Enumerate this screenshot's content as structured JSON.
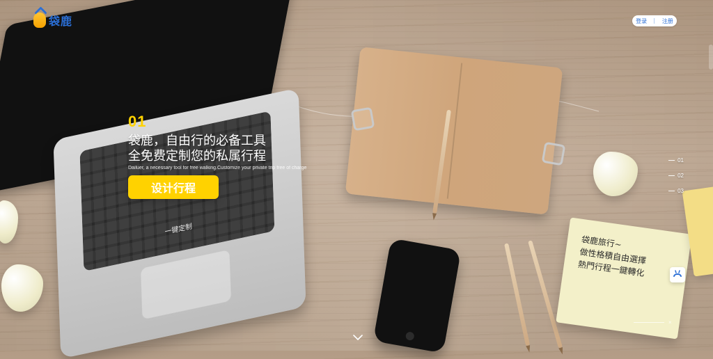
{
  "brand": {
    "name": "袋鹿"
  },
  "top_actions": {
    "login": "登录",
    "register": "注册"
  },
  "hero": {
    "index": "01",
    "title_line_1": "袋鹿，自由行的必备工具",
    "title_line_2": "全免费定制您的私属行程",
    "subtitle": "Dailuer, a necessary tool for free walking.Customize your private trip free of charge",
    "cta_label": "设计行程"
  },
  "laptop": {
    "key_label": "一键定制"
  },
  "pager": {
    "items": [
      "01",
      "02",
      "03"
    ]
  },
  "sticky_note": {
    "line_1": "袋鹿旅行~",
    "line_2": "做性格積自由選擇",
    "line_3": "熱門行程一鍵轉化"
  },
  "colors": {
    "accent": "#ffd200",
    "brand_blue": "#2b6fd6"
  },
  "icons": {
    "logo_mark": "deer-bag-icon",
    "scroll_down": "chevron-down-icon",
    "assistant": "deer-icon",
    "close": "close-icon"
  },
  "mini_ui": {
    "close_symbol": "×"
  }
}
